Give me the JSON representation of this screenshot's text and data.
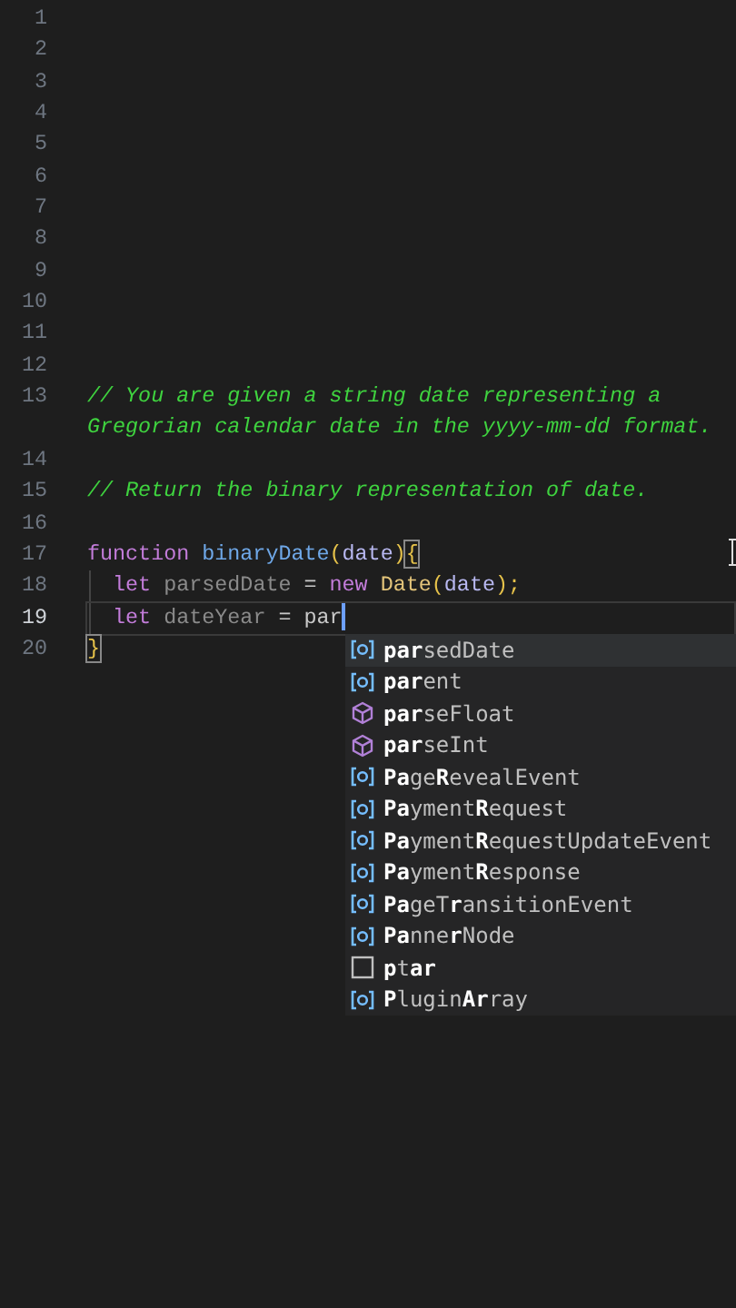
{
  "editor": {
    "lines": [
      {
        "number": "1",
        "current": false
      },
      {
        "number": "2",
        "current": false
      },
      {
        "number": "3",
        "current": false
      },
      {
        "number": "4",
        "current": false
      },
      {
        "number": "5",
        "current": false
      },
      {
        "number": "6",
        "current": false
      },
      {
        "number": "7",
        "current": false
      },
      {
        "number": "8",
        "current": false
      },
      {
        "number": "9",
        "current": false
      },
      {
        "number": "10",
        "current": false
      },
      {
        "number": "11",
        "current": false
      },
      {
        "number": "12",
        "current": false
      },
      {
        "number": "13",
        "current": false,
        "tokens": [
          {
            "kind": "comment",
            "text": "// You are given a string date representing a Gregorian calendar date in the yyyy-mm-dd format."
          }
        ]
      },
      {
        "number": "14",
        "current": false
      },
      {
        "number": "15",
        "current": false,
        "tokens": [
          {
            "kind": "comment",
            "text": "// Return the binary representation of date."
          }
        ]
      },
      {
        "number": "16",
        "current": false
      },
      {
        "number": "17",
        "current": false,
        "tokens": [
          {
            "kind": "keyword",
            "text": "function"
          },
          {
            "kind": "function",
            "text": "binaryDate"
          },
          {
            "kind": "paren",
            "text": "("
          },
          {
            "kind": "param",
            "text": "date"
          },
          {
            "kind": "paren",
            "text": ")"
          },
          {
            "kind": "bracket",
            "text": "{"
          }
        ]
      },
      {
        "number": "18",
        "current": false,
        "indent": true,
        "tokens": [
          {
            "kind": "keyword",
            "text": "let"
          },
          {
            "kind": "unused",
            "text": "parsedDate"
          },
          {
            "kind": "plain",
            "text": "="
          },
          {
            "kind": "keyword",
            "text": "new"
          },
          {
            "kind": "class",
            "text": "Date"
          },
          {
            "kind": "paren",
            "text": "("
          },
          {
            "kind": "param",
            "text": "date"
          },
          {
            "kind": "paren",
            "text": ");"
          }
        ]
      },
      {
        "number": "19",
        "current": true,
        "indent": true,
        "cursor": true,
        "tokens": [
          {
            "kind": "keyword",
            "text": "let"
          },
          {
            "kind": "unused",
            "text": "dateYear"
          },
          {
            "kind": "plain",
            "text": "="
          },
          {
            "kind": "plain",
            "text": "par"
          }
        ]
      },
      {
        "number": "20",
        "current": false,
        "tokens": [
          {
            "kind": "bracket",
            "text": "}"
          }
        ]
      }
    ]
  },
  "suggestions": [
    {
      "kind": "variable",
      "label": "**par**sedDate",
      "selected": true
    },
    {
      "kind": "variable",
      "label": "**par**ent",
      "selected": false
    },
    {
      "kind": "method",
      "label": "**par**seFloat",
      "selected": false
    },
    {
      "kind": "method",
      "label": "**par**seInt",
      "selected": false
    },
    {
      "kind": "variable",
      "label": "**Pa**ge**R**evealEvent",
      "selected": false
    },
    {
      "kind": "variable",
      "label": "**Pa**yment**R**equest",
      "selected": false
    },
    {
      "kind": "variable",
      "label": "**Pa**yment**R**equestUpdateEvent",
      "selected": false
    },
    {
      "kind": "variable",
      "label": "**Pa**yment**R**esponse",
      "selected": false
    },
    {
      "kind": "variable",
      "label": "**Pa**geT**r**ansitionEvent",
      "selected": false
    },
    {
      "kind": "variable",
      "label": "**Pa**nne**r**Node",
      "selected": false
    },
    {
      "kind": "text",
      "label": "**p**t**ar**",
      "selected": false
    },
    {
      "kind": "variable",
      "label": "**P**lugin**Ar**ray",
      "selected": false
    }
  ]
}
